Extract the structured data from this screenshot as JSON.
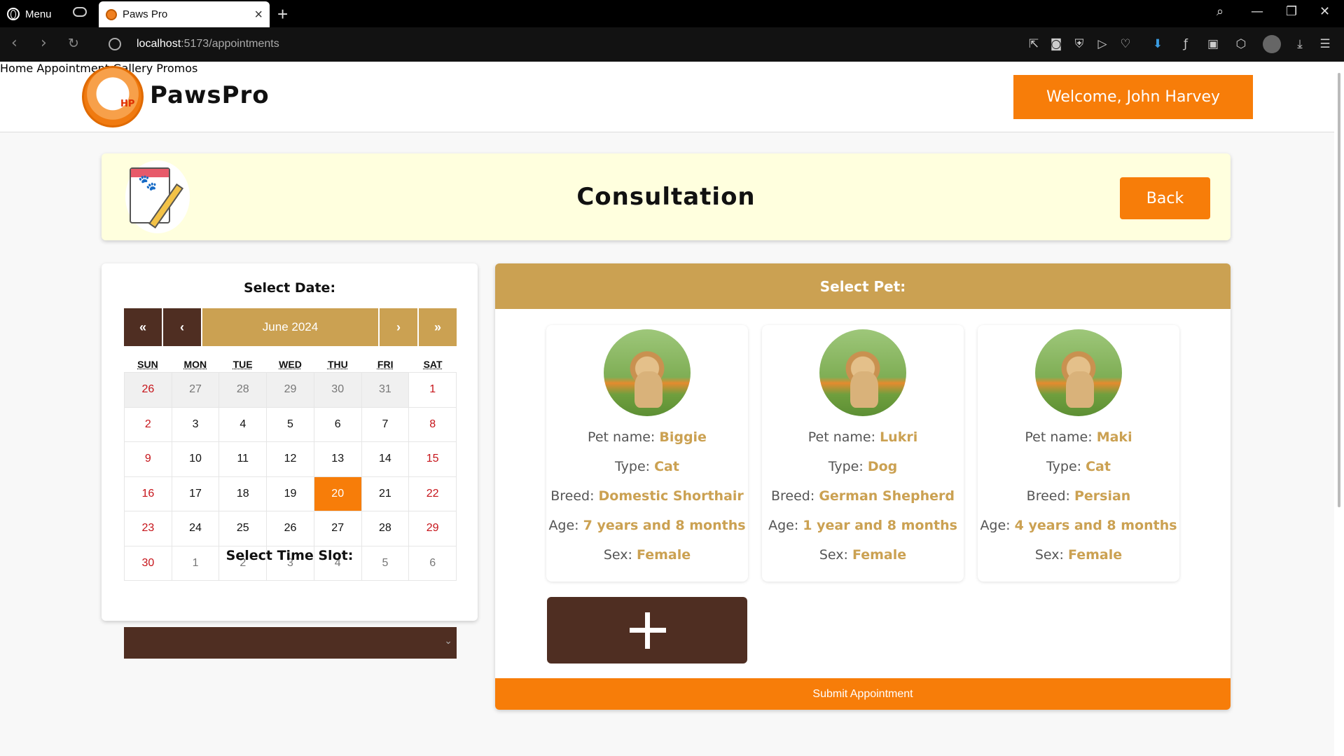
{
  "browser": {
    "menu_label": "Menu",
    "tab_title": "Paws Pro",
    "url_host": "localhost",
    "url_path": ":5173/appointments"
  },
  "header": {
    "brand": "PawsPro",
    "nav": [
      "Home",
      "Appointment",
      "Gallery",
      "Promos"
    ],
    "welcome": "Welcome, John Harvey"
  },
  "banner": {
    "title": "Consultation",
    "back_label": "Back"
  },
  "calendar": {
    "select_date_label": "Select Date:",
    "nav_first": "«",
    "nav_prev": "‹",
    "month": "June 2024",
    "nav_next": "›",
    "nav_last": "»",
    "weekdays": [
      "SUN",
      "MON",
      "TUE",
      "WED",
      "THU",
      "FRI",
      "SAT"
    ],
    "selected_day": "20",
    "days": [
      "26",
      "27",
      "28",
      "29",
      "30",
      "31",
      "1",
      "2",
      "3",
      "4",
      "5",
      "6",
      "7",
      "8",
      "9",
      "10",
      "11",
      "12",
      "13",
      "14",
      "15",
      "16",
      "17",
      "18",
      "19",
      "20",
      "21",
      "22",
      "23",
      "24",
      "25",
      "26",
      "27",
      "28",
      "29",
      "30",
      "1",
      "2",
      "3",
      "4",
      "5",
      "6"
    ],
    "time_slot_label": "Select Time Slot:"
  },
  "pets_panel": {
    "title": "Select Pet:",
    "labels": {
      "name": "Pet name:",
      "type": "Type:",
      "breed": "Breed:",
      "age": "Age:",
      "sex": "Sex:"
    },
    "pets": [
      {
        "name": "Biggie",
        "type": "Cat",
        "breed": "Domestic Shorthair",
        "age": "7 years and 8 months",
        "sex": "Female"
      },
      {
        "name": "Lukri",
        "type": "Dog",
        "breed": "German Shepherd",
        "age": "1 year and 8 months",
        "sex": "Female"
      },
      {
        "name": "Maki",
        "type": "Cat",
        "breed": "Persian",
        "age": "4 years and 8 months",
        "sex": "Female"
      }
    ],
    "submit_label": "Submit Appointment"
  },
  "colors": {
    "accent_orange": "#f77d09",
    "gold": "#cba152",
    "dark_brown": "#4f2e22",
    "banner_bg": "#ffffde",
    "weekend_red": "#c6141a"
  }
}
